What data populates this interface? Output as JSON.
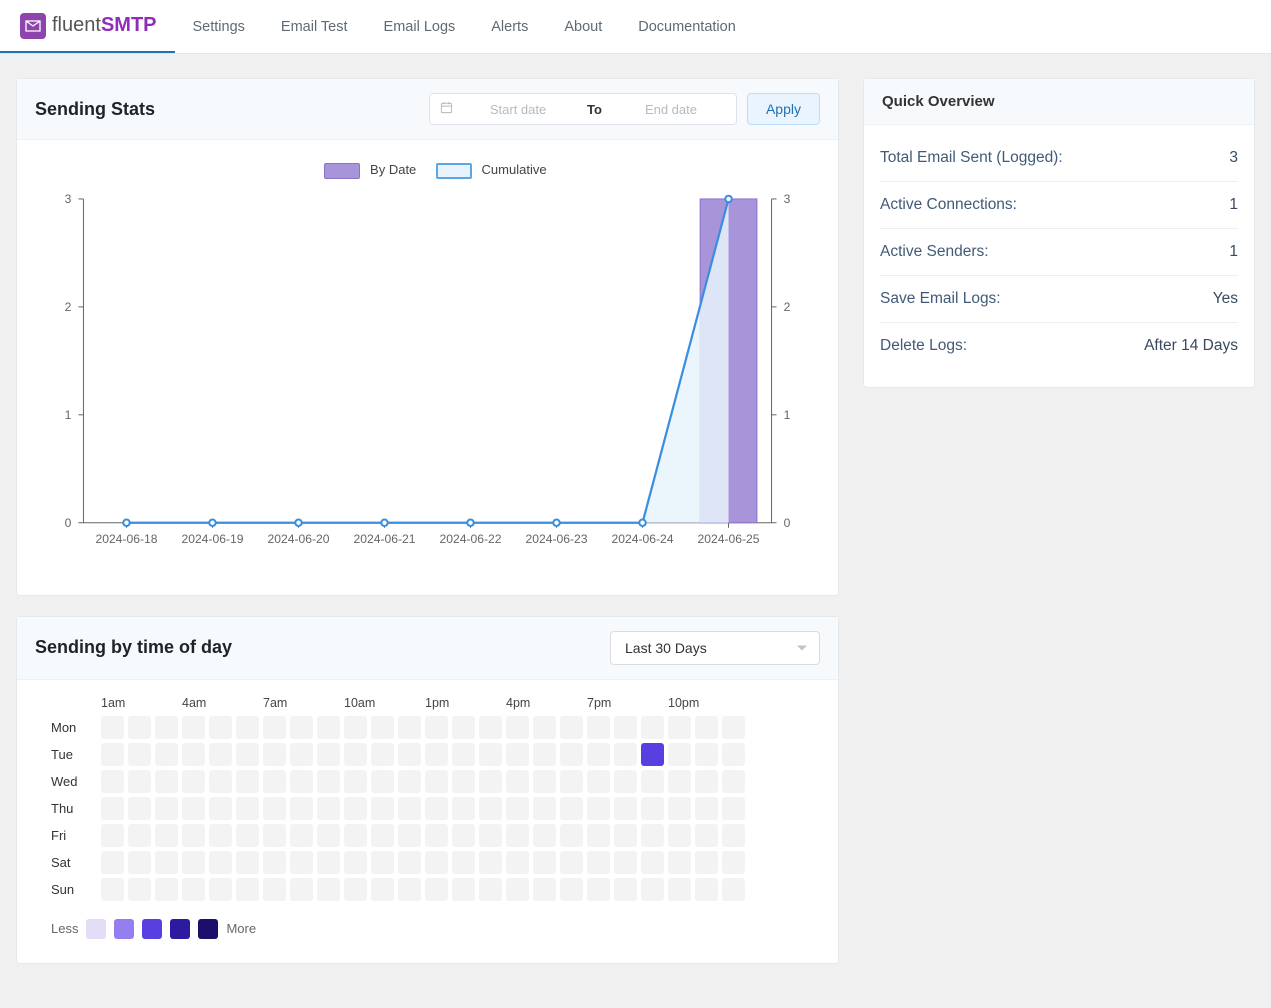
{
  "brand": {
    "prefix": "fluent",
    "suffix": "SMTP"
  },
  "nav": [
    "Settings",
    "Email Test",
    "Email Logs",
    "Alerts",
    "About",
    "Documentation"
  ],
  "stats": {
    "title": "Sending Stats",
    "start_ph": "Start date",
    "to": "To",
    "end_ph": "End date",
    "apply": "Apply",
    "legend": {
      "by_date": "By Date",
      "cumulative": "Cumulative"
    }
  },
  "chart_data": {
    "type": "bar",
    "categories": [
      "2024-06-18",
      "2024-06-19",
      "2024-06-20",
      "2024-06-21",
      "2024-06-22",
      "2024-06-23",
      "2024-06-24",
      "2024-06-25"
    ],
    "y_left": {
      "min": 0,
      "max": 3,
      "ticks": [
        0,
        1,
        2,
        3
      ]
    },
    "y_right": {
      "min": 0,
      "max": 3,
      "ticks": [
        0,
        1,
        2,
        3
      ]
    },
    "series": [
      {
        "name": "By Date",
        "kind": "bar",
        "axis": "left",
        "values": [
          0,
          0,
          0,
          0,
          0,
          0,
          0,
          3
        ]
      },
      {
        "name": "Cumulative",
        "kind": "line",
        "axis": "right",
        "values": [
          0,
          0,
          0,
          0,
          0,
          0,
          0,
          3
        ]
      }
    ]
  },
  "heat": {
    "title": "Sending by time of day",
    "range_label": "Last 30 Days",
    "days": [
      "Mon",
      "Tue",
      "Wed",
      "Thu",
      "Fri",
      "Sat",
      "Sun"
    ],
    "hour_labels": [
      "1am",
      "4am",
      "7am",
      "10am",
      "1pm",
      "4pm",
      "7pm",
      "10pm"
    ],
    "active": [
      [
        1,
        20
      ]
    ],
    "legend_less": "Less",
    "legend_more": "More"
  },
  "overview": {
    "title": "Quick Overview",
    "rows": [
      {
        "label": "Total Email Sent (Logged):",
        "value": "3"
      },
      {
        "label": "Active Connections:",
        "value": "1"
      },
      {
        "label": "Active Senders:",
        "value": "1"
      },
      {
        "label": "Save Email Logs:",
        "value": "Yes"
      },
      {
        "label": "Delete Logs:",
        "value": "After 14 Days"
      }
    ]
  }
}
